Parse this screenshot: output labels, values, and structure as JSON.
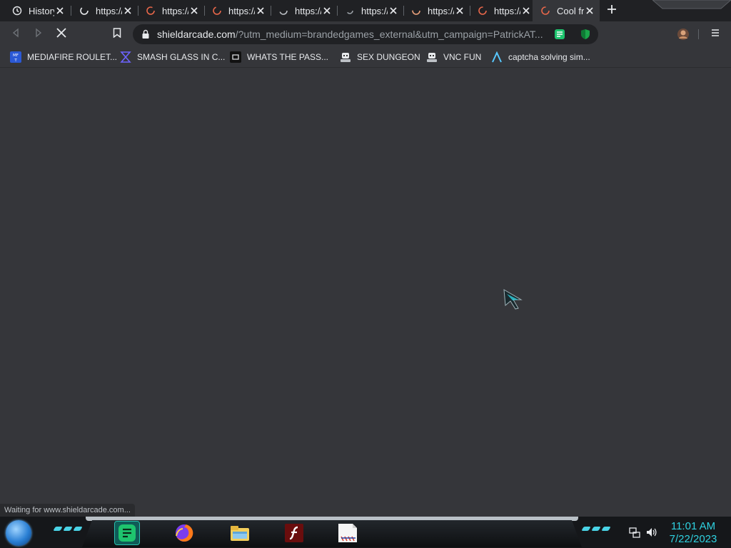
{
  "tabs": [
    {
      "title": "History",
      "icon": "history-icon",
      "active": false
    },
    {
      "title": "https://",
      "icon": "loading-spinner-icon",
      "active": false
    },
    {
      "title": "https://",
      "icon": "loading-spinner-icon",
      "active": false
    },
    {
      "title": "https://",
      "icon": "loading-spinner-icon",
      "active": false
    },
    {
      "title": "https://",
      "icon": "loading-spinner-icon",
      "active": false
    },
    {
      "title": "https://",
      "icon": "loading-spinner-icon",
      "active": false
    },
    {
      "title": "https://",
      "icon": "loading-spinner-icon",
      "active": false
    },
    {
      "title": "https://",
      "icon": "loading-spinner-icon",
      "active": false
    },
    {
      "title": "Cool fr",
      "icon": "loading-spinner-icon",
      "active": true
    }
  ],
  "toolbar": {
    "url_host": "shieldarcade.com",
    "url_rest": "/?utm_medium=brandedgames_external&utm_campaign=PatrickAT...",
    "extensions": [
      "notes-extension-icon",
      "shield-extension-icon"
    ]
  },
  "bookmarks": [
    {
      "label": "MEDIAFIRE ROULET...",
      "icon": "mediafire-icon"
    },
    {
      "label": "SMASH GLASS IN C...",
      "icon": "bracket-icon"
    },
    {
      "label": "WHATS THE PASS...",
      "icon": "terminal-icon"
    },
    {
      "label": "SEX DUNGEON",
      "icon": "robot-icon"
    },
    {
      "label": "VNC FUN",
      "icon": "robot-icon"
    },
    {
      "label": "captcha solving sim...",
      "icon": "lambda-icon"
    }
  ],
  "status": {
    "text": "Waiting for www.shieldarcade.com..."
  },
  "taskbar": {
    "apps": [
      "notes-app-icon",
      "firefox-icon",
      "file-explorer-icon",
      "flash-player-icon",
      "document-icon"
    ],
    "time": "11:01 AM",
    "date": "7/22/2023"
  },
  "colors": {
    "page_bg": "#35363a",
    "tab_strip": "#202124",
    "clock": "#2fd1e0",
    "accent_green": "#1ec46e"
  }
}
